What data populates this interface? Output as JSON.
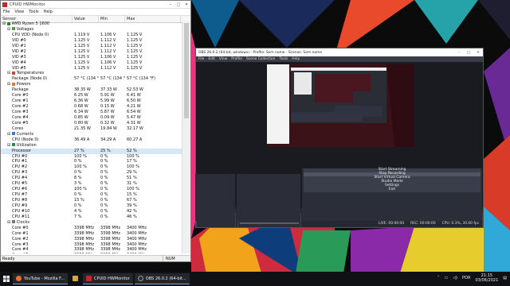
{
  "desktop": {
    "wallpaper": "colorful-geometric"
  },
  "hwmonitor": {
    "title": "CPUID HWMonitor",
    "menu": [
      "File",
      "View",
      "Tools",
      "Help"
    ],
    "columns": [
      "Sensor",
      "Value",
      "Min",
      "Max"
    ],
    "rows": [
      {
        "indent": 1,
        "icon": "cpu",
        "sensor": "AMD Ryzen 5 1600",
        "value": "",
        "min": "",
        "max": ""
      },
      {
        "indent": 2,
        "icon": "voltage",
        "sensor": "Voltages",
        "value": "",
        "min": "",
        "max": ""
      },
      {
        "indent": 3,
        "icon": "",
        "sensor": "CPU VDD (Node 0)",
        "value": "1.119 V",
        "min": "1.106 V",
        "max": "1.125 V"
      },
      {
        "indent": 3,
        "icon": "",
        "sensor": "VID #0",
        "value": "1.125 V",
        "min": "1.112 V",
        "max": "1.125 V"
      },
      {
        "indent": 3,
        "icon": "",
        "sensor": "VID #1",
        "value": "1.125 V",
        "min": "1.112 V",
        "max": "1.125 V"
      },
      {
        "indent": 3,
        "icon": "",
        "sensor": "VID #2",
        "value": "1.125 V",
        "min": "1.112 V",
        "max": "1.125 V"
      },
      {
        "indent": 3,
        "icon": "",
        "sensor": "VID #3",
        "value": "1.125 V",
        "min": "1.106 V",
        "max": "1.125 V"
      },
      {
        "indent": 3,
        "icon": "",
        "sensor": "VID #4",
        "value": "1.125 V",
        "min": "1.106 V",
        "max": "1.125 V"
      },
      {
        "indent": 3,
        "icon": "",
        "sensor": "VID #5",
        "value": "1.125 V",
        "min": "1.112 V",
        "max": "1.125 V"
      },
      {
        "indent": 2,
        "icon": "temp",
        "sensor": "Temperatures",
        "value": "",
        "min": "",
        "max": ""
      },
      {
        "indent": 3,
        "icon": "",
        "sensor": "Package (Node 0)",
        "value": "57 °C  (134 °F)",
        "min": "57 °C  (134 °F)",
        "max": "57 °C  (134 °F)"
      },
      {
        "indent": 2,
        "icon": "power",
        "sensor": "Powers",
        "value": "",
        "min": "",
        "max": ""
      },
      {
        "indent": 3,
        "icon": "",
        "sensor": "Package",
        "value": "38.35 W",
        "min": "37.33 W",
        "max": "52.53 W"
      },
      {
        "indent": 3,
        "icon": "",
        "sensor": "Core #0",
        "value": "6.25 W",
        "min": "5.91 W",
        "max": "6.41 W"
      },
      {
        "indent": 3,
        "icon": "",
        "sensor": "Core #1",
        "value": "6.36 W",
        "min": "5.99 W",
        "max": "6.50 W"
      },
      {
        "indent": 3,
        "icon": "",
        "sensor": "Core #2",
        "value": "0.68 W",
        "min": "0.15 W",
        "max": "4.21 W"
      },
      {
        "indent": 3,
        "icon": "",
        "sensor": "Core #3",
        "value": "6.34 W",
        "min": "5.87 W",
        "max": "6.54 W"
      },
      {
        "indent": 3,
        "icon": "",
        "sensor": "Core #4",
        "value": "0.85 W",
        "min": "0.09 W",
        "max": "5.47 W"
      },
      {
        "indent": 3,
        "icon": "",
        "sensor": "Core #5",
        "value": "0.80 W",
        "min": "0.32 W",
        "max": "4.31 W"
      },
      {
        "indent": 3,
        "icon": "",
        "sensor": "Cores",
        "value": "21.35 W",
        "min": "19.84 W",
        "max": "32.17 W"
      },
      {
        "indent": 2,
        "icon": "current",
        "sensor": "Currents",
        "value": "",
        "min": "",
        "max": ""
      },
      {
        "indent": 3,
        "icon": "",
        "sensor": "CPU (Node 0)",
        "value": "36.49 A",
        "min": "34.29 A",
        "max": "60.27 A"
      },
      {
        "indent": 2,
        "icon": "util",
        "sensor": "Utilization",
        "value": "",
        "min": "",
        "max": ""
      },
      {
        "indent": 3,
        "icon": "",
        "sensor": "Processor",
        "value": "27 %",
        "min": "25 %",
        "max": "52 %"
      },
      {
        "indent": 3,
        "icon": "",
        "sensor": "CPU #0",
        "value": "100 %",
        "min": "0 %",
        "max": "100 %"
      },
      {
        "indent": 3,
        "icon": "",
        "sensor": "CPU #1",
        "value": "0 %",
        "min": "0 %",
        "max": "17 %"
      },
      {
        "indent": 3,
        "icon": "",
        "sensor": "CPU #2",
        "value": "100 %",
        "min": "0 %",
        "max": "100 %"
      },
      {
        "indent": 3,
        "icon": "",
        "sensor": "CPU #3",
        "value": "0 %",
        "min": "0 %",
        "max": "29 %"
      },
      {
        "indent": 3,
        "icon": "",
        "sensor": "CPU #4",
        "value": "8 %",
        "min": "0 %",
        "max": "51 %"
      },
      {
        "indent": 3,
        "icon": "",
        "sensor": "CPU #5",
        "value": "3 %",
        "min": "0 %",
        "max": "31 %"
      },
      {
        "indent": 3,
        "icon": "",
        "sensor": "CPU #6",
        "value": "100 %",
        "min": "0 %",
        "max": "100 %"
      },
      {
        "indent": 3,
        "icon": "",
        "sensor": "CPU #7",
        "value": "0 %",
        "min": "0 %",
        "max": "15 %"
      },
      {
        "indent": 3,
        "icon": "",
        "sensor": "CPU #8",
        "value": "15 %",
        "min": "0 %",
        "max": "67 %"
      },
      {
        "indent": 3,
        "icon": "",
        "sensor": "CPU #9",
        "value": "0 %",
        "min": "0 %",
        "max": "39 %"
      },
      {
        "indent": 3,
        "icon": "",
        "sensor": "CPU #10",
        "value": "4 %",
        "min": "0 %",
        "max": "42 %"
      },
      {
        "indent": 3,
        "icon": "",
        "sensor": "CPU #11",
        "value": "7 %",
        "min": "0 %",
        "max": "46 %"
      },
      {
        "indent": 2,
        "icon": "clock",
        "sensor": "Clocks",
        "value": "",
        "min": "",
        "max": ""
      },
      {
        "indent": 3,
        "icon": "",
        "sensor": "Core #0",
        "value": "3398 MHz",
        "min": "3398 MHz",
        "max": "3400 MHz"
      },
      {
        "indent": 3,
        "icon": "",
        "sensor": "Core #1",
        "value": "3398 MHz",
        "min": "3398 MHz",
        "max": "3400 MHz"
      },
      {
        "indent": 3,
        "icon": "",
        "sensor": "Core #2",
        "value": "3398 MHz",
        "min": "3398 MHz",
        "max": "3400 MHz"
      },
      {
        "indent": 3,
        "icon": "",
        "sensor": "Core #3",
        "value": "3398 MHz",
        "min": "3398 MHz",
        "max": "3400 MHz"
      },
      {
        "indent": 3,
        "icon": "",
        "sensor": "Core #4",
        "value": "3398 MHz",
        "min": "3398 MHz",
        "max": "3400 MHz"
      },
      {
        "indent": 3,
        "icon": "",
        "sensor": "Core #5",
        "value": "3398 MHz",
        "min": "3398 MHz",
        "max": "3400 MHz"
      }
    ],
    "status_left": "Ready",
    "status_num": "NUM"
  },
  "obs": {
    "title": "OBS 26.0.2 (64-bit, windows) - Profile: Sem nome - Scenes: Sem nome",
    "menu": [
      "File",
      "Edit",
      "View",
      "Profile",
      "Scene Collection",
      "Tools",
      "Help"
    ],
    "source_note": "No source selected",
    "docks": {
      "sources": {
        "header": "Sources",
        "items": [
          "Display Capture"
        ]
      },
      "mixer": {
        "header": "Audio Mixer",
        "items": [
          "Desktop Audio"
        ],
        "level": "0.0 dB"
      },
      "controls": {
        "header": "Controls",
        "buttons": [
          "Start Streaming",
          "Stop Recording",
          "Start Virtual Camera",
          "Studio Mode",
          "Settings",
          "Exit"
        ],
        "active_index": 1
      }
    },
    "status": {
      "live": "LIVE: 00:00:00",
      "rec": "REC: 00:00:00",
      "cpu": "CPU: 0.3%, 30.00 fps"
    }
  },
  "taskbar": {
    "tasks": [
      {
        "label": "YouTube - Mozilla F...",
        "icon_color": "#e8712c"
      },
      {
        "label": "",
        "icon_color": "#d8a93a"
      },
      {
        "label": "CPUID HWMonitor",
        "icon_color": "#c0282d"
      },
      {
        "label": "OBS 26.0.2 (64-bit...",
        "icon_color": "#2d2d2d"
      }
    ],
    "lang": "POR",
    "time": "21:15",
    "date": "03/06/2021"
  }
}
